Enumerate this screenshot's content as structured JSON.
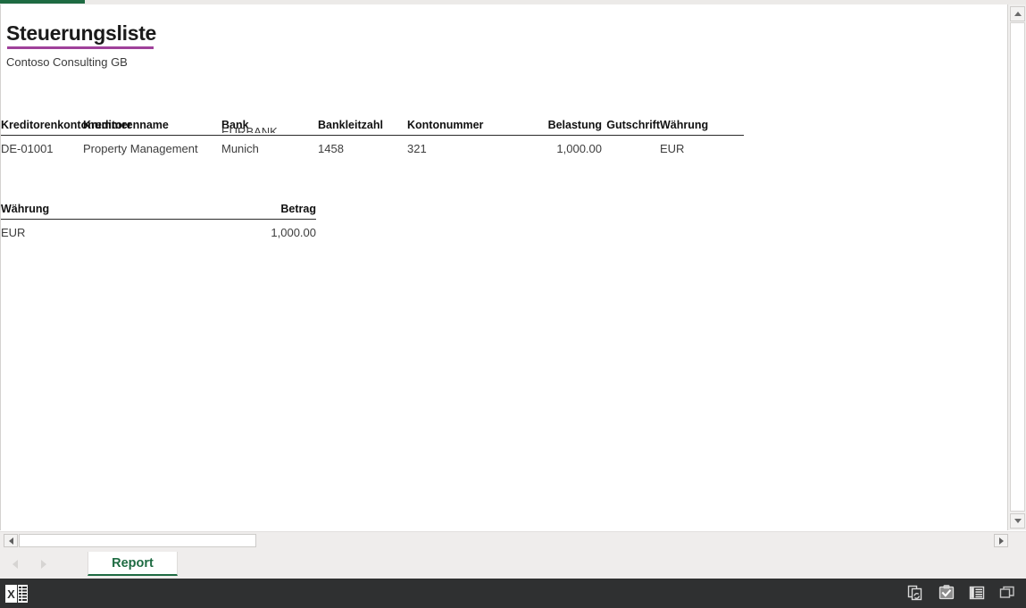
{
  "window": {
    "accent_color": "#1e6b42"
  },
  "report": {
    "title": "Steuerungsliste",
    "subtitle": "Contoso Consulting GB",
    "title_rule_color": "#9f419a"
  },
  "detail_table": {
    "columns": [
      {
        "label": "Kreditorenkontonummer",
        "align": "left"
      },
      {
        "label": "Kreditorenname",
        "align": "left"
      },
      {
        "label": "Bank",
        "align": "left"
      },
      {
        "label": "Bankleitzahl",
        "align": "left"
      },
      {
        "label": "Kontonummer",
        "align": "left"
      },
      {
        "label": "Belastung",
        "align": "right"
      },
      {
        "label": "Gutschrift",
        "align": "right"
      },
      {
        "label": "Währung",
        "align": "left"
      }
    ],
    "rows": [
      {
        "kreditorenkontonummer": "DE-01001",
        "kreditorenname": "Property Management",
        "bank_overflow": "EURBANK",
        "bank": "Munich",
        "bankleitzahl": "1458",
        "kontonummer": "321",
        "belastung": "1,000.00",
        "gutschrift": "",
        "waehrung": "EUR"
      }
    ]
  },
  "summary_table": {
    "columns": [
      {
        "label": "Währung",
        "align": "left"
      },
      {
        "label": "Betrag",
        "align": "right"
      }
    ],
    "rows": [
      {
        "waehrung": "EUR",
        "betrag": "1,000.00"
      }
    ]
  },
  "tabbar": {
    "prev_icon": "triangle-left-icon",
    "next_icon": "triangle-right-icon",
    "active_tab": "Report"
  },
  "scrollbars": {
    "vertical_up_icon": "triangle-up-icon",
    "vertical_down_icon": "triangle-down-icon",
    "horizontal_left_icon": "triangle-left-icon",
    "horizontal_right_icon": "triangle-right-icon"
  },
  "statusbar": {
    "app_icon": "excel-icon",
    "icons": [
      "refresh-sync-icon",
      "clipboard-check-icon",
      "list-view-icon",
      "restore-window-icon"
    ]
  }
}
